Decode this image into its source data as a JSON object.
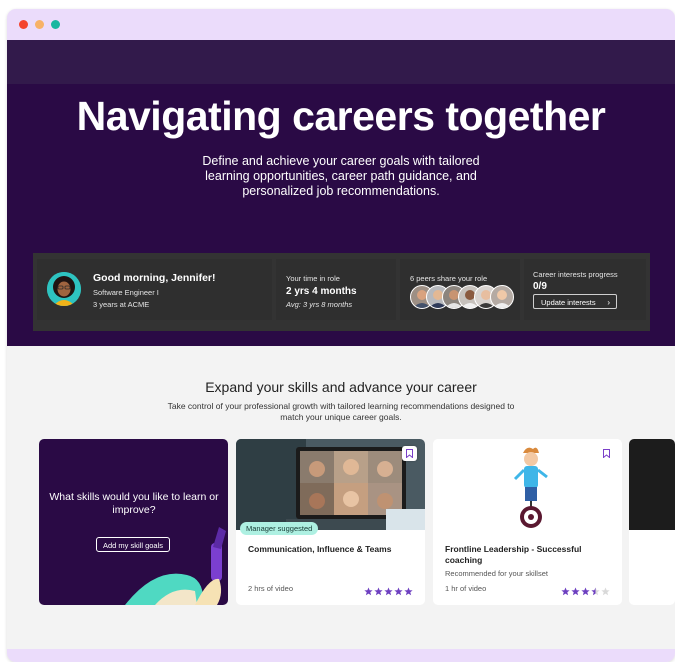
{
  "hero": {
    "title": "Navigating careers together",
    "description": "Define and achieve your career goals with tailored learning opportunities, career path guidance, and personalized job recommendations."
  },
  "status": {
    "greeting": "Good morning, Jennifer!",
    "role": "Software Engineer I",
    "tenure": "3 years at ACME",
    "time_label": "Your time in role",
    "time_value": "2 yrs 4 months",
    "time_avg": "Avg: 3 yrs 8 months",
    "peers_label": "6 peers share your role",
    "interests_label": "Career interests progress",
    "interests_value": "0/9",
    "update_button": "Update interests"
  },
  "skills": {
    "title": "Expand your skills and advance your career",
    "description": "Take control of your professional growth with tailored learning recommendations designed to match your unique career goals."
  },
  "prompt_card": {
    "question": "What skills would you like to learn or improve?",
    "button": "Add my skill goals"
  },
  "courses": [
    {
      "badge": "Manager suggested",
      "title": "Communication, Influence & Teams",
      "subtitle": "",
      "meta": "2 hrs of video",
      "rating": 5
    },
    {
      "badge": "",
      "title": "Frontline Leadership - Successful coaching",
      "subtitle": "Recommended for your skillset",
      "meta": "1 hr of video",
      "rating": 3.5
    }
  ],
  "colors": {
    "hero_bg": "#2a0a45",
    "accent": "#6d3fc0",
    "badge_bg": "#aef0e2",
    "window_chrome": "#ebdcfb"
  },
  "icons": [
    "close-dot",
    "minimize-dot",
    "maximize-dot",
    "bookmark-icon",
    "star-icon",
    "chevron-right-icon"
  ]
}
